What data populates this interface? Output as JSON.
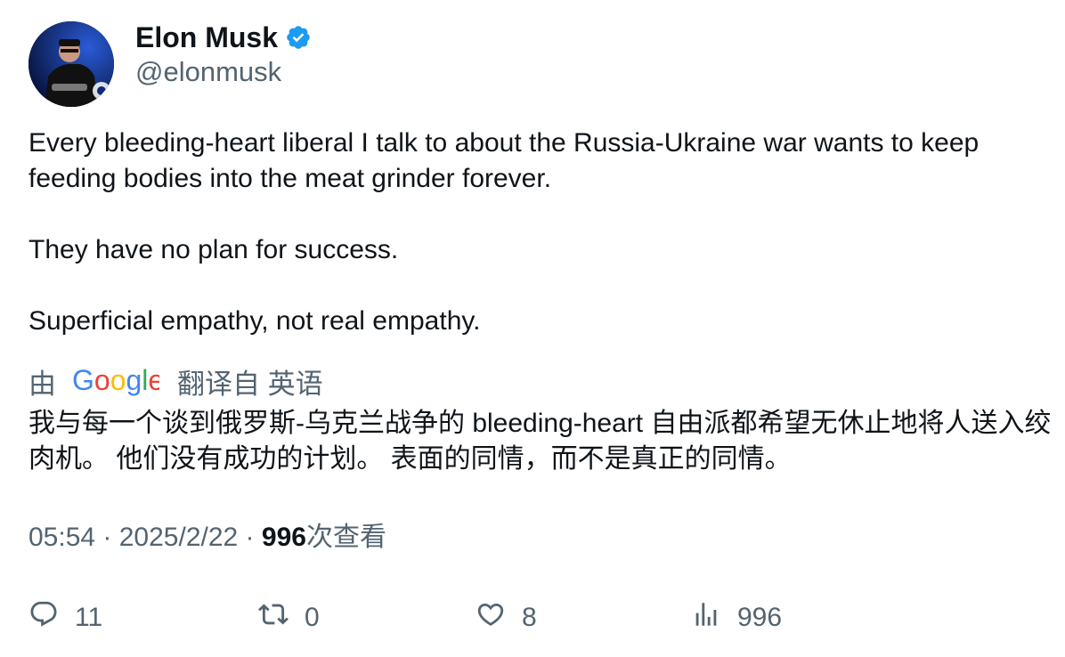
{
  "author": {
    "name": "Elon Musk",
    "handle": "@elonmusk",
    "avatar_icon": "profile-photo",
    "verified_icon": "verified-badge-icon",
    "verified_color": "#1d9bf0"
  },
  "tweet": {
    "paragraphs": [
      "Every bleeding-heart liberal I talk to about the Russia-Ukraine war wants to keep feeding bodies into the meat grinder forever.",
      "They have no plan for success.",
      "Superficial empathy, not real empathy."
    ]
  },
  "translation": {
    "prefix": "由",
    "provider": "Google",
    "suffix": "翻译自 英语",
    "text": "我与每一个谈到俄罗斯-乌克兰战争的 bleeding-heart 自由派都希望无休止地将人送入绞肉机。 他们没有成功的计划。 表面的同情，而不是真正的同情。"
  },
  "meta": {
    "time": "05:54",
    "sep1": " · ",
    "date": "2025/2/22",
    "sep2": " · ",
    "views_count": "996",
    "views_label": "次查看"
  },
  "actions": {
    "reply": {
      "icon": "reply-icon",
      "count": "11"
    },
    "retweet": {
      "icon": "retweet-icon",
      "count": "0"
    },
    "like": {
      "icon": "heart-icon",
      "count": "8"
    },
    "views": {
      "icon": "bar-chart-icon",
      "count": "996"
    }
  }
}
